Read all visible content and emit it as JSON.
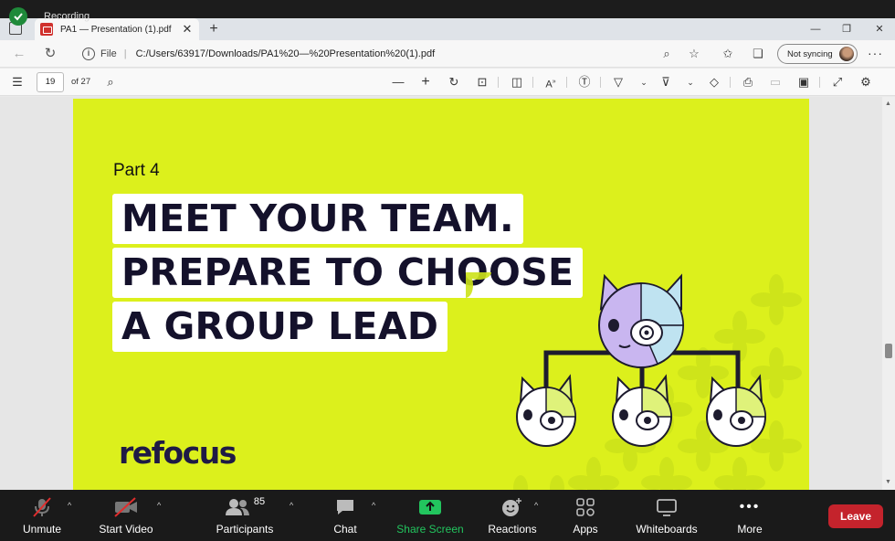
{
  "recording": {
    "label": "Recording"
  },
  "browser": {
    "tab_title": "PA1 — Presentation (1).pdf",
    "address_scheme": "File",
    "url": "C:/Users/63917/Downloads/PA1%20—%20Presentation%20(1).pdf",
    "sync_label": "Not syncing"
  },
  "pdf_toolbar": {
    "page_number": "19",
    "page_total": "of 27"
  },
  "slide": {
    "part_label": "Part 4",
    "headline_lines": [
      "MEET YOUR TEAM.",
      "PREPARE TO CHOOSE",
      "A GROUP LEAD"
    ],
    "brand": "refocus",
    "background_color": "#dcf01c",
    "text_color": "#14112b"
  },
  "meeting_toolbar": {
    "unmute": "Unmute",
    "start_video": "Start Video",
    "participants": "Participants",
    "participants_count": "85",
    "chat": "Chat",
    "share_screen": "Share Screen",
    "reactions": "Reactions",
    "apps": "Apps",
    "whiteboards": "Whiteboards",
    "more": "More",
    "leave": "Leave",
    "share_color": "#22c55e",
    "leave_color": "#c4232c"
  }
}
